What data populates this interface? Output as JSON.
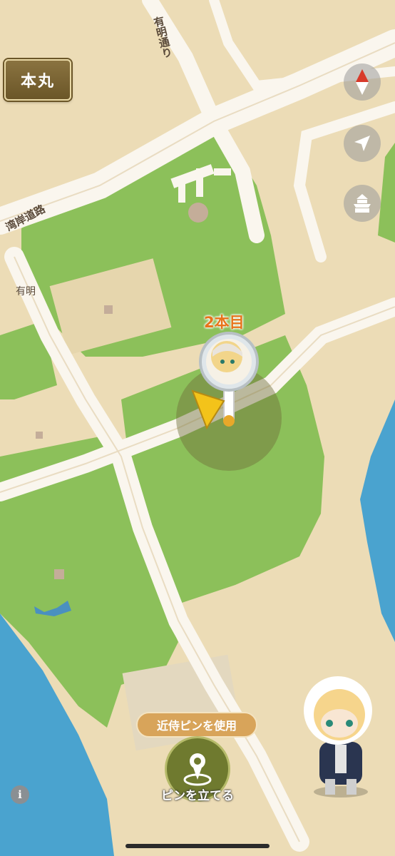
{
  "header": {
    "honmaru_label": "本丸"
  },
  "map": {
    "road_labels": {
      "ariake_dori": "有明通り",
      "wangan_doro": "湾岸道路",
      "ariake": "有明"
    },
    "pin_label": "2本目"
  },
  "controls": {
    "compass_icon": "compass-icon",
    "locate_icon": "location-arrow-icon",
    "castle_icon": "castle-icon"
  },
  "bottom": {
    "use_pin_label": "近侍ピンを使用",
    "set_pin_label": "ピンを立てる",
    "info_label": "i"
  },
  "colors": {
    "land": "#ecdcb6",
    "park": "#8cc05a",
    "water": "#4aa3cf",
    "road": "#faf6ee",
    "accent_orange": "#e8731a"
  }
}
